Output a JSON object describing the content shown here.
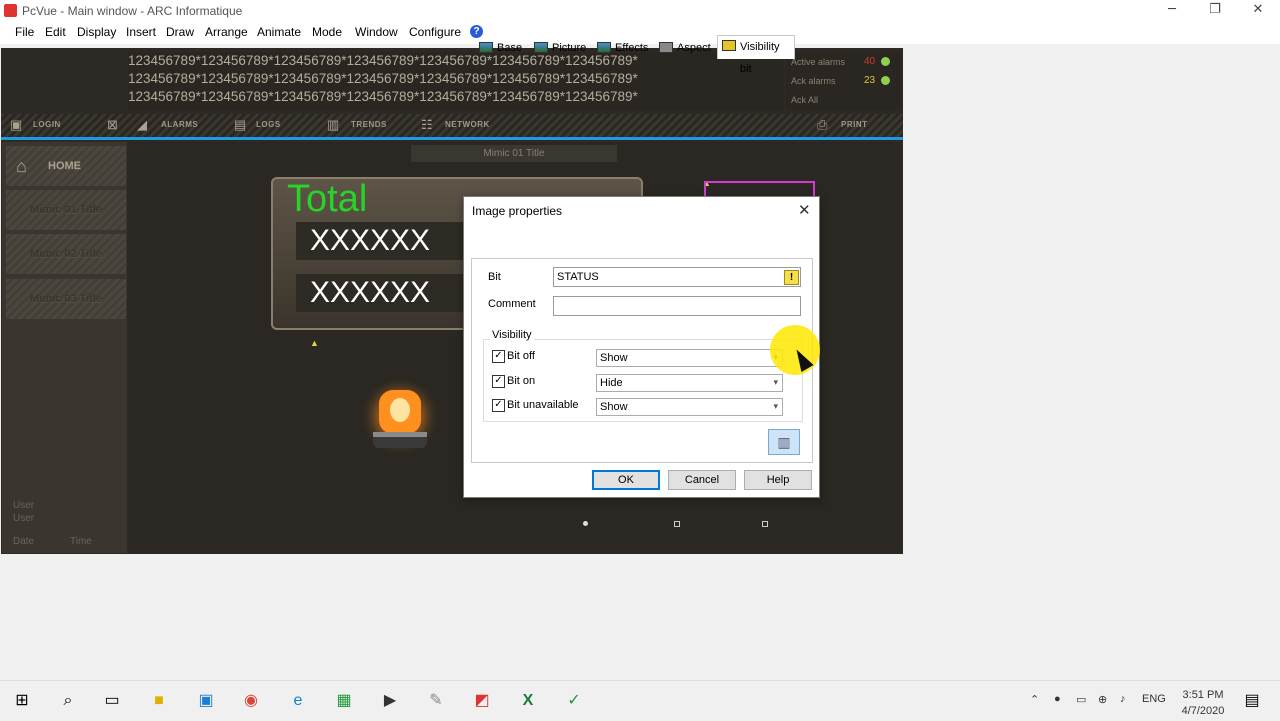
{
  "window": {
    "title": "PcVue - Main window - ARC Informatique"
  },
  "menu": [
    "File",
    "Edit",
    "Display",
    "Insert",
    "Draw",
    "Arrange",
    "Animate",
    "Mode",
    "Window",
    "Configure"
  ],
  "alarm_banner": {
    "lines": [
      "123456789*123456789*123456789*123456789*123456789*123456789*123456789*",
      "123456789*123456789*123456789*123456789*123456789*123456789*123456789*",
      "123456789*123456789*123456789*123456789*123456789*123456789*123456789*"
    ],
    "active_label": "Active alarms",
    "active_count": "40",
    "ack_label": "Ack alarms",
    "ack_count": "23",
    "ackall_label": "Ack All"
  },
  "nav": {
    "login": "LOGIN",
    "alarms": "ALARMS",
    "logs": "LOGS",
    "trends": "TRENDS",
    "network": "NETWORK",
    "print": "PRINT"
  },
  "sidebar": {
    "home": "HOME",
    "items": [
      "Mimic 01 Title",
      "Mimic 02 Title",
      "Mimic 03 Title"
    ],
    "user1": "User",
    "user2": "User",
    "date": "Date",
    "time": "Time"
  },
  "mimic": {
    "title": "Mimic 01 Title",
    "total_label": "Total",
    "values": [
      "XXXXXX",
      "XXXXXX"
    ]
  },
  "dialog": {
    "title": "Image properties",
    "tabs": [
      "Base",
      "Picture",
      "Effects",
      "Aspect",
      "Visibility bit"
    ],
    "bit_label": "Bit",
    "bit_value": "STATUS",
    "comment_label": "Comment",
    "comment_value": "",
    "visibility_label": "Visibility",
    "rows": [
      {
        "label": "Bit off",
        "checked": true,
        "value": "Show"
      },
      {
        "label": "Bit on",
        "checked": true,
        "value": "Hide"
      },
      {
        "label": "Bit unavailable",
        "checked": true,
        "value": "Show"
      }
    ],
    "ok": "OK",
    "cancel": "Cancel",
    "help": "Help"
  },
  "taskbar": {
    "language": "ENG",
    "time": "3:51 PM",
    "date": "4/7/2020"
  }
}
